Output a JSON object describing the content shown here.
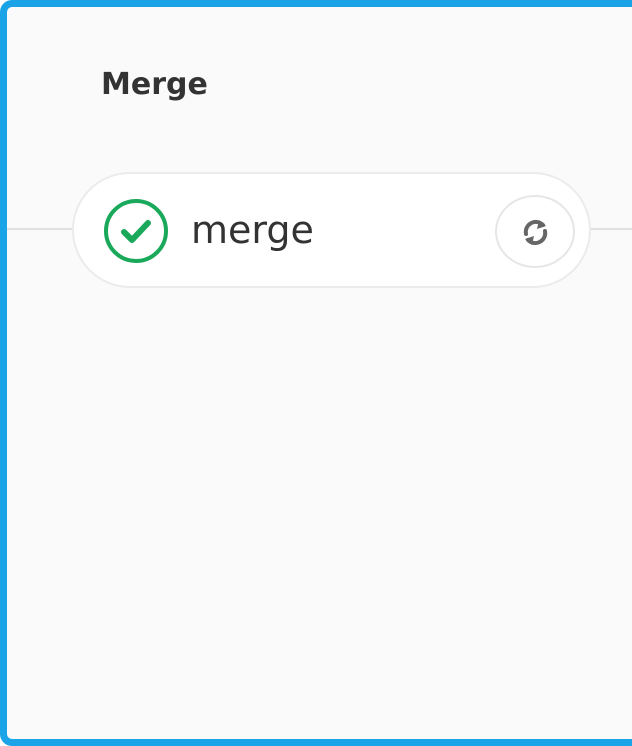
{
  "stage": {
    "title": "Merge"
  },
  "job": {
    "name": "merge",
    "status": "passed",
    "status_icon": "check-circle-icon",
    "action_icon": "retry-icon"
  },
  "colors": {
    "frame_border": "#1aa3e6",
    "status_success": "#1aa85b",
    "icon_gray": "#666666"
  }
}
